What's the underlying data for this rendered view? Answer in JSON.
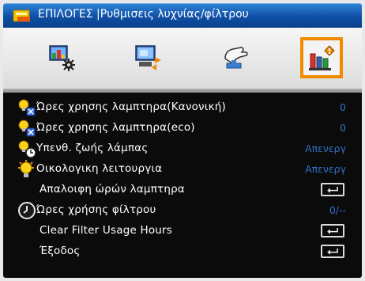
{
  "header": {
    "title": "ΕΠΙΛΟΓΕΣ |Ρυθμισεις λυχνίας/φίλτρου"
  },
  "tabs": [
    {
      "icon": "display-image-icon",
      "active": false
    },
    {
      "icon": "settings-screen-icon",
      "active": false
    },
    {
      "icon": "hand-setup-icon",
      "active": false
    },
    {
      "icon": "options-lamp-icon",
      "active": true
    }
  ],
  "menu": {
    "items": [
      {
        "label": "Ώρες χρησης λαμπτηρα(Κανονική)",
        "value": "0",
        "icon": "lamp-normal-icon"
      },
      {
        "label": "Ώρες χρησης λαμπτηρα(eco)",
        "value": "0",
        "icon": "lamp-eco-icon"
      },
      {
        "label": "Υπενθ. ζωής λάμπας",
        "value": "Απενεργ",
        "icon": "lamp-reminder-icon"
      },
      {
        "label": "Οικολογικη λειτουργια",
        "value": "Απενεργ",
        "icon": "eco-mode-icon"
      },
      {
        "label": "Απαλοιφη ώρών λαμπτηρα",
        "value": "",
        "icon": ""
      },
      {
        "label": "Ώρες χρήσης φίλτρου",
        "value": "0/--",
        "icon": "clock-icon"
      },
      {
        "label": "Clear Filter Usage Hours",
        "value": "",
        "icon": ""
      },
      {
        "label": "Έξοδος",
        "value": "",
        "icon": ""
      }
    ]
  },
  "colors": {
    "accent": "#f08a00",
    "title_bar": "#0f4fa5",
    "value_text": "#3273c8"
  }
}
